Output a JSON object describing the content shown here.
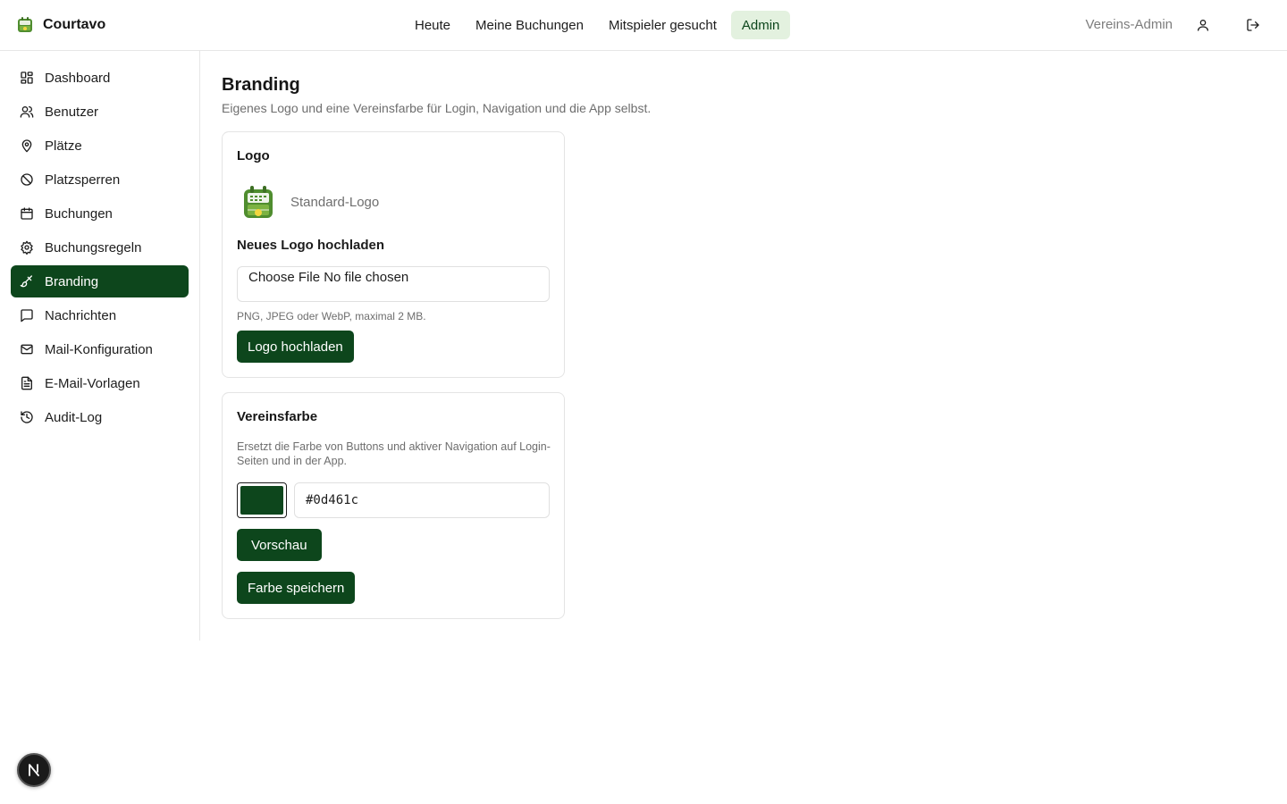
{
  "app": {
    "name": "Courtavo",
    "logo_icon": "tennis-court-logo-icon"
  },
  "topnav": [
    {
      "label": "Heute",
      "active": false
    },
    {
      "label": "Meine Buchungen",
      "active": false
    },
    {
      "label": "Mitspieler gesucht",
      "active": false
    },
    {
      "label": "Admin",
      "active": true
    }
  ],
  "user": {
    "label": "Vereins-Admin",
    "profile_icon": "user-icon",
    "logout_icon": "logout-icon"
  },
  "sidebar": {
    "items": [
      {
        "label": "Dashboard",
        "icon": "dashboard-icon",
        "active": false
      },
      {
        "label": "Benutzer",
        "icon": "users-icon",
        "active": false
      },
      {
        "label": "Plätze",
        "icon": "map-pin-icon",
        "active": false
      },
      {
        "label": "Platzsperren",
        "icon": "ban-icon",
        "active": false
      },
      {
        "label": "Buchungen",
        "icon": "calendar-icon",
        "active": false
      },
      {
        "label": "Buchungsregeln",
        "icon": "gear-icon",
        "active": false
      },
      {
        "label": "Branding",
        "icon": "brush-icon",
        "active": true
      },
      {
        "label": "Nachrichten",
        "icon": "message-icon",
        "active": false
      },
      {
        "label": "Mail-Konfiguration",
        "icon": "mail-icon",
        "active": false
      },
      {
        "label": "E-Mail-Vorlagen",
        "icon": "file-text-icon",
        "active": false
      },
      {
        "label": "Audit-Log",
        "icon": "history-icon",
        "active": false
      }
    ]
  },
  "page": {
    "title": "Branding",
    "subtitle": "Eigenes Logo und eine Vereinsfarbe für Login, Navigation und die App selbst."
  },
  "logo_card": {
    "title": "Logo",
    "current_logo_label": "Standard-Logo",
    "upload_label": "Neues Logo hochladen",
    "file_input_text": "Choose File No file chosen",
    "hint": "PNG, JPEG oder WebP, maximal 2 MB.",
    "upload_button": "Logo hochladen"
  },
  "color_card": {
    "title": "Vereinsfarbe",
    "description": "Ersetzt die Farbe von Buttons und aktiver Navigation auf Login-Seiten und in der App.",
    "color_value": "#0d461c",
    "preview_button": "Vorschau",
    "save_button": "Farbe speichern"
  },
  "colors": {
    "accent": "#0d461c",
    "active_nav_bg": "#e3f1df"
  },
  "dev_badge": {
    "letter": "N",
    "icon": "nextjs-dev-icon"
  }
}
